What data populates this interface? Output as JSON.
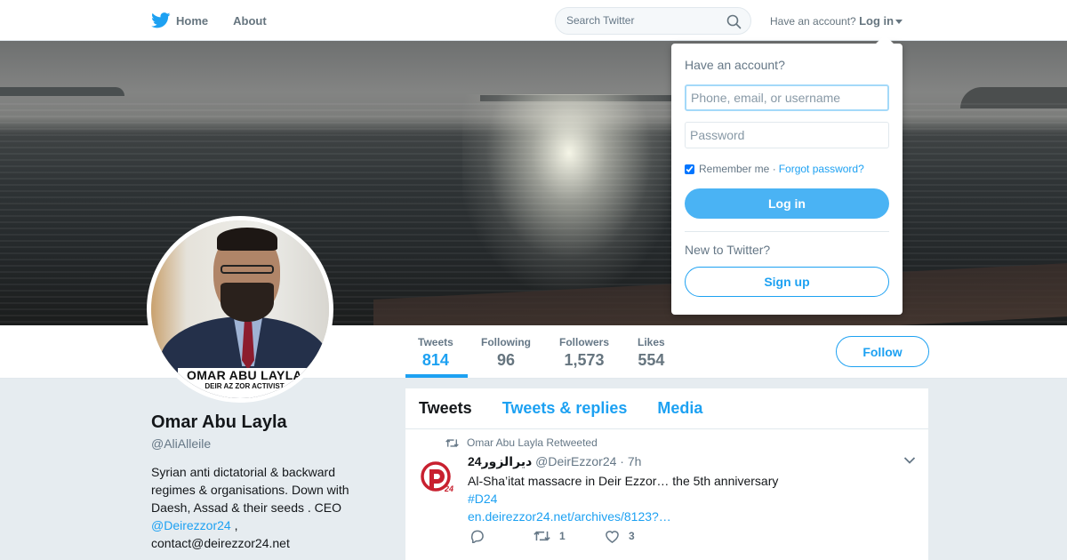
{
  "nav": {
    "home_label": "Home",
    "about_label": "About",
    "search_placeholder": "Search Twitter",
    "have_account": "Have an account?",
    "login_label": "Log in",
    "brand_color": "#1da1f2"
  },
  "profile": {
    "name": "Omar Abu Layla",
    "handle": "@AliAlleile",
    "bio_text": "Syrian anti dictatorial & backward regimes & organisations. Down with Daesh, Assad & their seeds . CEO",
    "bio_link": "@Deirezzor24",
    "bio_sep": " ,",
    "bio_contact": "contact@deirezzor24.net",
    "avatar_caption_line1": "OMAR ABU LAYLA",
    "avatar_caption_line2": "DEIR AZ ZOR ACTIVIST"
  },
  "stats": [
    {
      "label": "Tweets",
      "value": "814"
    },
    {
      "label": "Following",
      "value": "96"
    },
    {
      "label": "Followers",
      "value": "1,573"
    },
    {
      "label": "Likes",
      "value": "554"
    }
  ],
  "follow_label": "Follow",
  "timeline": {
    "tabs": [
      "Tweets",
      "Tweets & replies",
      "Media"
    ],
    "active_tab": "Tweets",
    "tweet": {
      "retweet_note": "Omar Abu Layla Retweeted",
      "author_name": "ديرالزور24",
      "author_handle": "@DeirEzzor24",
      "time": "7h",
      "text": "Al-Sha’itat massacre in Deir Ezzor… the 5th anniversary",
      "hashtag": "#D24",
      "link": "en.deirezzor24.net/archives/8123?…",
      "retweets": "1",
      "likes": "3"
    }
  },
  "login_dropdown": {
    "title": "Have an account?",
    "username_placeholder": "Phone, email, or username",
    "password_placeholder": "Password",
    "remember_label": "Remember me",
    "separator": "·",
    "forgot_label": "Forgot password?",
    "login_button": "Log in",
    "new_label": "New to Twitter?",
    "signup_button": "Sign up"
  }
}
